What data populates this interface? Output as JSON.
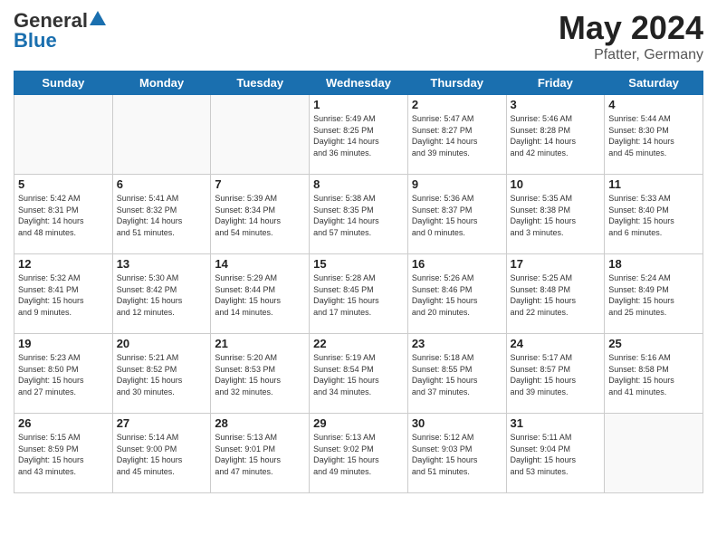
{
  "header": {
    "logo_general": "General",
    "logo_blue": "Blue",
    "month_year": "May 2024",
    "location": "Pfatter, Germany"
  },
  "days_of_week": [
    "Sunday",
    "Monday",
    "Tuesday",
    "Wednesday",
    "Thursday",
    "Friday",
    "Saturday"
  ],
  "weeks": [
    [
      {
        "day": "",
        "info": ""
      },
      {
        "day": "",
        "info": ""
      },
      {
        "day": "",
        "info": ""
      },
      {
        "day": "1",
        "info": "Sunrise: 5:49 AM\nSunset: 8:25 PM\nDaylight: 14 hours\nand 36 minutes."
      },
      {
        "day": "2",
        "info": "Sunrise: 5:47 AM\nSunset: 8:27 PM\nDaylight: 14 hours\nand 39 minutes."
      },
      {
        "day": "3",
        "info": "Sunrise: 5:46 AM\nSunset: 8:28 PM\nDaylight: 14 hours\nand 42 minutes."
      },
      {
        "day": "4",
        "info": "Sunrise: 5:44 AM\nSunset: 8:30 PM\nDaylight: 14 hours\nand 45 minutes."
      }
    ],
    [
      {
        "day": "5",
        "info": "Sunrise: 5:42 AM\nSunset: 8:31 PM\nDaylight: 14 hours\nand 48 minutes."
      },
      {
        "day": "6",
        "info": "Sunrise: 5:41 AM\nSunset: 8:32 PM\nDaylight: 14 hours\nand 51 minutes."
      },
      {
        "day": "7",
        "info": "Sunrise: 5:39 AM\nSunset: 8:34 PM\nDaylight: 14 hours\nand 54 minutes."
      },
      {
        "day": "8",
        "info": "Sunrise: 5:38 AM\nSunset: 8:35 PM\nDaylight: 14 hours\nand 57 minutes."
      },
      {
        "day": "9",
        "info": "Sunrise: 5:36 AM\nSunset: 8:37 PM\nDaylight: 15 hours\nand 0 minutes."
      },
      {
        "day": "10",
        "info": "Sunrise: 5:35 AM\nSunset: 8:38 PM\nDaylight: 15 hours\nand 3 minutes."
      },
      {
        "day": "11",
        "info": "Sunrise: 5:33 AM\nSunset: 8:40 PM\nDaylight: 15 hours\nand 6 minutes."
      }
    ],
    [
      {
        "day": "12",
        "info": "Sunrise: 5:32 AM\nSunset: 8:41 PM\nDaylight: 15 hours\nand 9 minutes."
      },
      {
        "day": "13",
        "info": "Sunrise: 5:30 AM\nSunset: 8:42 PM\nDaylight: 15 hours\nand 12 minutes."
      },
      {
        "day": "14",
        "info": "Sunrise: 5:29 AM\nSunset: 8:44 PM\nDaylight: 15 hours\nand 14 minutes."
      },
      {
        "day": "15",
        "info": "Sunrise: 5:28 AM\nSunset: 8:45 PM\nDaylight: 15 hours\nand 17 minutes."
      },
      {
        "day": "16",
        "info": "Sunrise: 5:26 AM\nSunset: 8:46 PM\nDaylight: 15 hours\nand 20 minutes."
      },
      {
        "day": "17",
        "info": "Sunrise: 5:25 AM\nSunset: 8:48 PM\nDaylight: 15 hours\nand 22 minutes."
      },
      {
        "day": "18",
        "info": "Sunrise: 5:24 AM\nSunset: 8:49 PM\nDaylight: 15 hours\nand 25 minutes."
      }
    ],
    [
      {
        "day": "19",
        "info": "Sunrise: 5:23 AM\nSunset: 8:50 PM\nDaylight: 15 hours\nand 27 minutes."
      },
      {
        "day": "20",
        "info": "Sunrise: 5:21 AM\nSunset: 8:52 PM\nDaylight: 15 hours\nand 30 minutes."
      },
      {
        "day": "21",
        "info": "Sunrise: 5:20 AM\nSunset: 8:53 PM\nDaylight: 15 hours\nand 32 minutes."
      },
      {
        "day": "22",
        "info": "Sunrise: 5:19 AM\nSunset: 8:54 PM\nDaylight: 15 hours\nand 34 minutes."
      },
      {
        "day": "23",
        "info": "Sunrise: 5:18 AM\nSunset: 8:55 PM\nDaylight: 15 hours\nand 37 minutes."
      },
      {
        "day": "24",
        "info": "Sunrise: 5:17 AM\nSunset: 8:57 PM\nDaylight: 15 hours\nand 39 minutes."
      },
      {
        "day": "25",
        "info": "Sunrise: 5:16 AM\nSunset: 8:58 PM\nDaylight: 15 hours\nand 41 minutes."
      }
    ],
    [
      {
        "day": "26",
        "info": "Sunrise: 5:15 AM\nSunset: 8:59 PM\nDaylight: 15 hours\nand 43 minutes."
      },
      {
        "day": "27",
        "info": "Sunrise: 5:14 AM\nSunset: 9:00 PM\nDaylight: 15 hours\nand 45 minutes."
      },
      {
        "day": "28",
        "info": "Sunrise: 5:13 AM\nSunset: 9:01 PM\nDaylight: 15 hours\nand 47 minutes."
      },
      {
        "day": "29",
        "info": "Sunrise: 5:13 AM\nSunset: 9:02 PM\nDaylight: 15 hours\nand 49 minutes."
      },
      {
        "day": "30",
        "info": "Sunrise: 5:12 AM\nSunset: 9:03 PM\nDaylight: 15 hours\nand 51 minutes."
      },
      {
        "day": "31",
        "info": "Sunrise: 5:11 AM\nSunset: 9:04 PM\nDaylight: 15 hours\nand 53 minutes."
      },
      {
        "day": "",
        "info": ""
      }
    ]
  ]
}
